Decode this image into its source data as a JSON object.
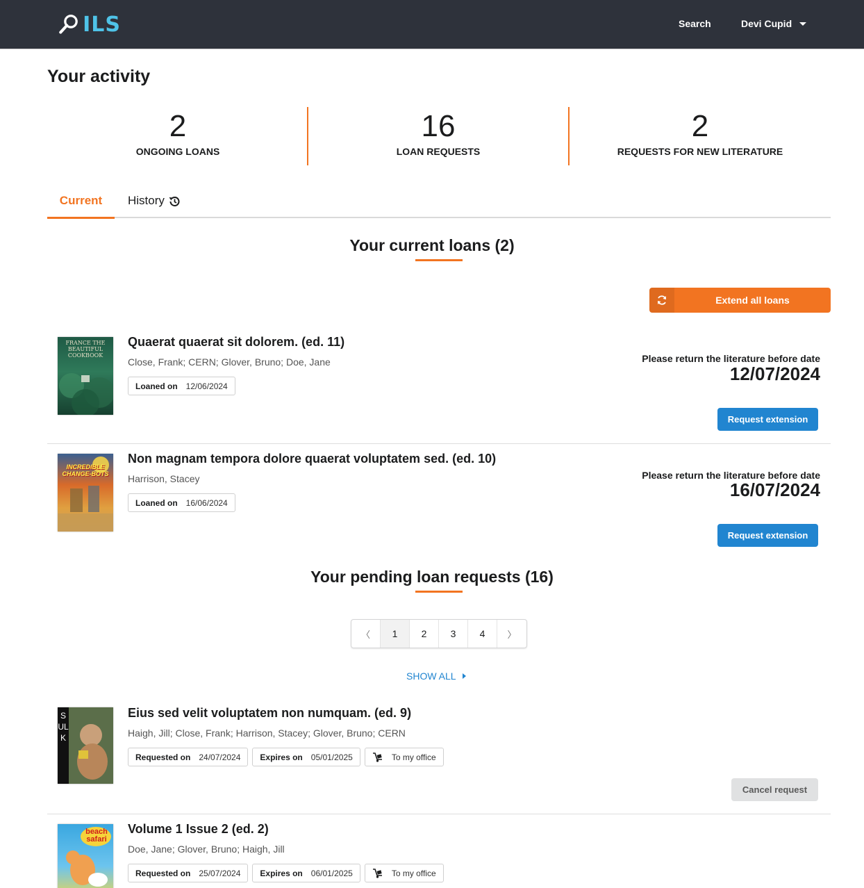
{
  "header": {
    "logo_text": "ILS",
    "nav_search": "Search",
    "user_name": "Devi Cupid"
  },
  "page": {
    "title": "Your activity"
  },
  "stats": [
    {
      "value": "2",
      "label": "ONGOING LOANS"
    },
    {
      "value": "16",
      "label": "LOAN REQUESTS"
    },
    {
      "value": "2",
      "label": "REQUESTS FOR NEW LITERATURE"
    }
  ],
  "tabs": {
    "current": "Current",
    "history": "History"
  },
  "loans": {
    "title": "Your current loans (2)",
    "extend_all": "Extend all loans",
    "due_label": "Please return the literature before date",
    "extension_button": "Request extension",
    "items": [
      {
        "title": "Quaerat quaerat sit dolorem. (ed. 11)",
        "authors": "Close, Frank; CERN; Glover, Bruno; Doe, Jane",
        "loaned_label": "Loaned on",
        "loaned_on": "12/06/2024",
        "due_date": "12/07/2024",
        "cover_text": "FRANCE THE BEAUTIFUL COOKBOOK"
      },
      {
        "title": "Non magnam tempora dolore quaerat voluptatem sed. (ed. 10)",
        "authors": "Harrison, Stacey",
        "loaned_label": "Loaned on",
        "loaned_on": "16/06/2024",
        "due_date": "16/07/2024",
        "cover_text": "INCREDIBLE CHANGE-BOTS"
      }
    ]
  },
  "requests": {
    "title": "Your pending loan requests (16)",
    "pagination": {
      "prev": "〈",
      "pages": [
        "1",
        "2",
        "3",
        "4"
      ],
      "next": "〉",
      "active": "1"
    },
    "show_all": "SHOW ALL",
    "cancel_button": "Cancel request",
    "items": [
      {
        "title": "Eius sed velit voluptatem non numquam. (ed. 9)",
        "authors": "Haigh, Jill; Close, Frank; Harrison, Stacey; Glover, Bruno; CERN",
        "requested_label": "Requested on",
        "requested_on": "24/07/2024",
        "expires_label": "Expires on",
        "expires_on": "05/01/2025",
        "delivery": "To my office",
        "cover_text": "SULK"
      },
      {
        "title": "Volume 1 Issue 2 (ed. 2)",
        "authors": "Doe, Jane; Glover, Bruno; Haigh, Jill",
        "requested_label": "Requested on",
        "requested_on": "25/07/2024",
        "expires_label": "Expires on",
        "expires_on": "06/01/2025",
        "delivery": "To my office",
        "cover_text": "beach safari"
      }
    ]
  },
  "colors": {
    "accent": "#f27421",
    "primary": "#2185d0",
    "topbar": "#2e323b",
    "logo": "#4fc3e8"
  }
}
